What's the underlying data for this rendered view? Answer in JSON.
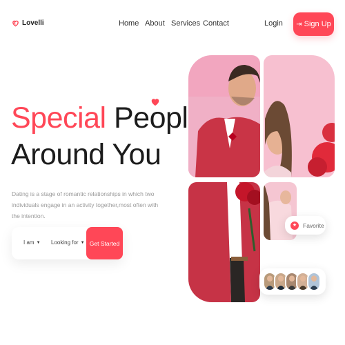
{
  "brand": {
    "name": "Lovelli",
    "icon": "heart-outline-icon",
    "accent": "#ff4757"
  },
  "nav": {
    "links": [
      "Home",
      "About",
      "Services",
      "Contact"
    ],
    "login": "Login",
    "signup": "Sign Up",
    "signup_icon": "login-arrow-icon"
  },
  "hero": {
    "headline_accent": "Special",
    "headline_rest": "People",
    "headline_line2": "Around You",
    "description": "Dating is a stage of romantic relationships in which two individuals engage in an activity together,most often with the intention."
  },
  "search": {
    "iam_label": "I am",
    "looking_for_label": "Looking for",
    "cta": "Get Started"
  },
  "favorite": {
    "label": "Favorite",
    "icon": "star-icon"
  },
  "avatars": {
    "count": 5
  }
}
